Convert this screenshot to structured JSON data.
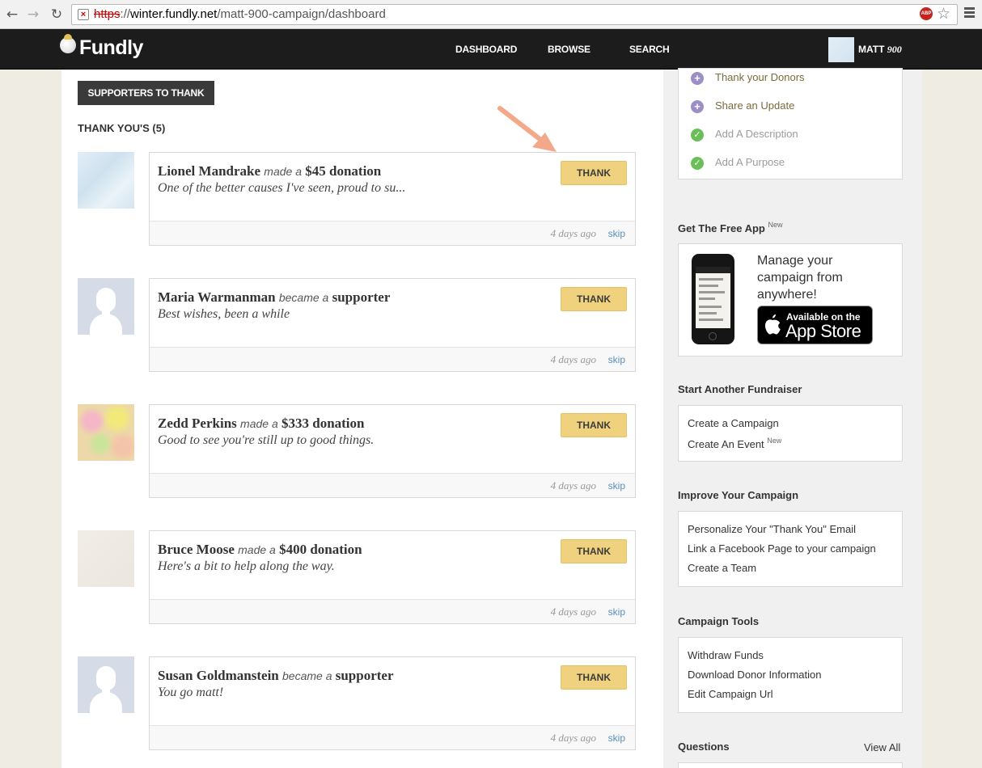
{
  "browser": {
    "url_scheme": "https",
    "url_sep": "://",
    "url_host": "winter.fundly.net",
    "url_path": "/matt-900-campaign/dashboard",
    "abp_label": "ABP"
  },
  "topnav": {
    "logo": "Fundly",
    "links": [
      "DASHBOARD",
      "BROWSE",
      "SEARCH"
    ],
    "user_first": "MATT",
    "user_last": "900"
  },
  "main": {
    "tab_label": "SUPPORTERS TO THANK",
    "count_heading": "THANK YOU'S (5)",
    "thank_label": "THANK",
    "skip_label": "skip",
    "entries": [
      {
        "name": "Lionel Mandrake",
        "verb": "made a",
        "what": "$45 donation",
        "message": "One of the better causes I've seen, proud to su...",
        "time": "4 days ago",
        "avatar": "blue"
      },
      {
        "name": "Maria Warmanman",
        "verb": "became a",
        "what": "supporter",
        "message": "Best wishes, been a while",
        "time": "4 days ago",
        "avatar": "silhouette"
      },
      {
        "name": "Zedd Perkins",
        "verb": "made a",
        "what": "$333 donation",
        "message": "Good to see you're still up to good things.",
        "time": "4 days ago",
        "avatar": "flower"
      },
      {
        "name": "Bruce Moose",
        "verb": "made a",
        "what": "$400 donation",
        "message": "Here's a bit to help along the way.",
        "time": "4 days ago",
        "avatar": "paper"
      },
      {
        "name": "Susan Goldmanstein",
        "verb": "became a",
        "what": "supporter",
        "message": "You go matt!",
        "time": "4 days ago",
        "avatar": "silhouette"
      }
    ]
  },
  "sidebar": {
    "todos": [
      {
        "label": "Thank your Donors",
        "done": false
      },
      {
        "label": "Share an Update",
        "done": false
      },
      {
        "label": "Add A Description",
        "done": true
      },
      {
        "label": "Add A Purpose",
        "done": true
      }
    ],
    "app_heading": "Get The Free App",
    "new_tag": "New",
    "app_text": "Manage your campaign from anywhere!",
    "appstore_small": "Available on the",
    "appstore_big": "App Store",
    "start_heading": "Start Another Fundraiser",
    "start_links": [
      "Create a Campaign",
      "Create An Event"
    ],
    "improve_heading": "Improve Your Campaign",
    "improve_links": [
      "Personalize Your \"Thank You\" Email",
      "Link a Facebook Page to your campaign",
      "Create a Team"
    ],
    "tools_heading": "Campaign Tools",
    "tools_links": [
      "Withdraw Funds",
      "Download Donor Information",
      "Edit Campaign Url"
    ],
    "questions_heading": "Questions",
    "view_all": "View All"
  },
  "colors": {
    "thank_button": "#f0d27e",
    "nav_bg": "#1c1c1c",
    "page_bg": "#efece3",
    "skip_link": "#5a8fc0",
    "arrow": "#f3a88a"
  }
}
